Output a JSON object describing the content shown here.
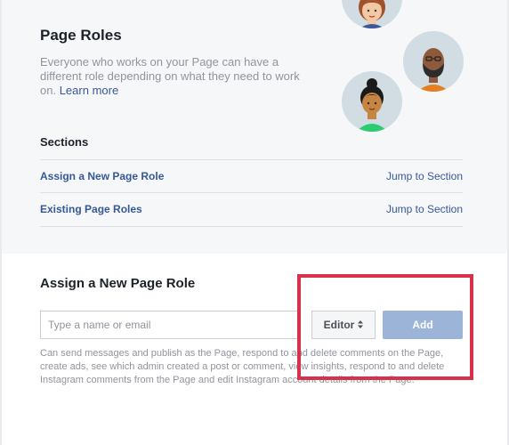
{
  "header": {
    "title": "Page Roles",
    "description": "Everyone who works on your Page can have a different role depending on what they need to work on.",
    "learn_more": "Learn more"
  },
  "avatars": [
    {
      "name": "avatar-woman-icon"
    },
    {
      "name": "avatar-man-beard-icon"
    },
    {
      "name": "avatar-woman-bun-icon"
    }
  ],
  "sections": {
    "heading": "Sections",
    "items": [
      {
        "label": "Assign a New Page Role",
        "jump": "Jump to Section"
      },
      {
        "label": "Existing Page Roles",
        "jump": "Jump to Section"
      }
    ]
  },
  "assign": {
    "title": "Assign a New Page Role",
    "input_placeholder": "Type a name or email",
    "input_value": "",
    "role_selected": "Editor",
    "add_label": "Add",
    "role_description": "Can send messages and publish as the Page, respond to and delete comments on the Page, create ads, see which admin created a post or comment, view insights, respond to and delete Instagram comments from the Page and edit Instagram account details from the Page."
  },
  "colors": {
    "link": "#365899",
    "add_button_disabled": "#9cb4d8",
    "highlight": "#d9304c",
    "avatar_bg": "#d1dce3"
  }
}
